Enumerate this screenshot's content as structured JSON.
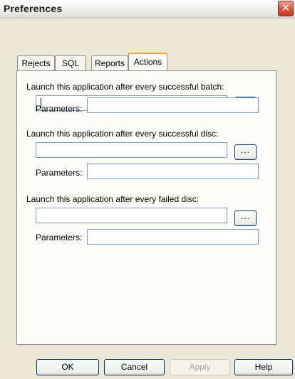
{
  "window": {
    "title": "Preferences"
  },
  "tabs": [
    {
      "label": "Rejects",
      "active": false
    },
    {
      "label": "SQL",
      "active": false
    },
    {
      "label": "Reports",
      "active": false
    },
    {
      "label": "Actions",
      "active": true
    }
  ],
  "sections": [
    {
      "label": "Launch this application after every successful batch:",
      "path_value": "",
      "browse_label": "...",
      "params_label": "Parameters:",
      "params_value": ""
    },
    {
      "label": "Launch this application after every successful disc:",
      "path_value": "",
      "browse_label": "...",
      "params_label": "Parameters:",
      "params_value": ""
    },
    {
      "label": "Launch this application after every failed disc:",
      "path_value": "",
      "browse_label": "...",
      "params_label": "Parameters:",
      "params_value": ""
    }
  ],
  "buttons": {
    "ok": "OK",
    "cancel": "Cancel",
    "apply": "Apply",
    "help": "Help"
  },
  "icons": {
    "close": "close-icon"
  }
}
